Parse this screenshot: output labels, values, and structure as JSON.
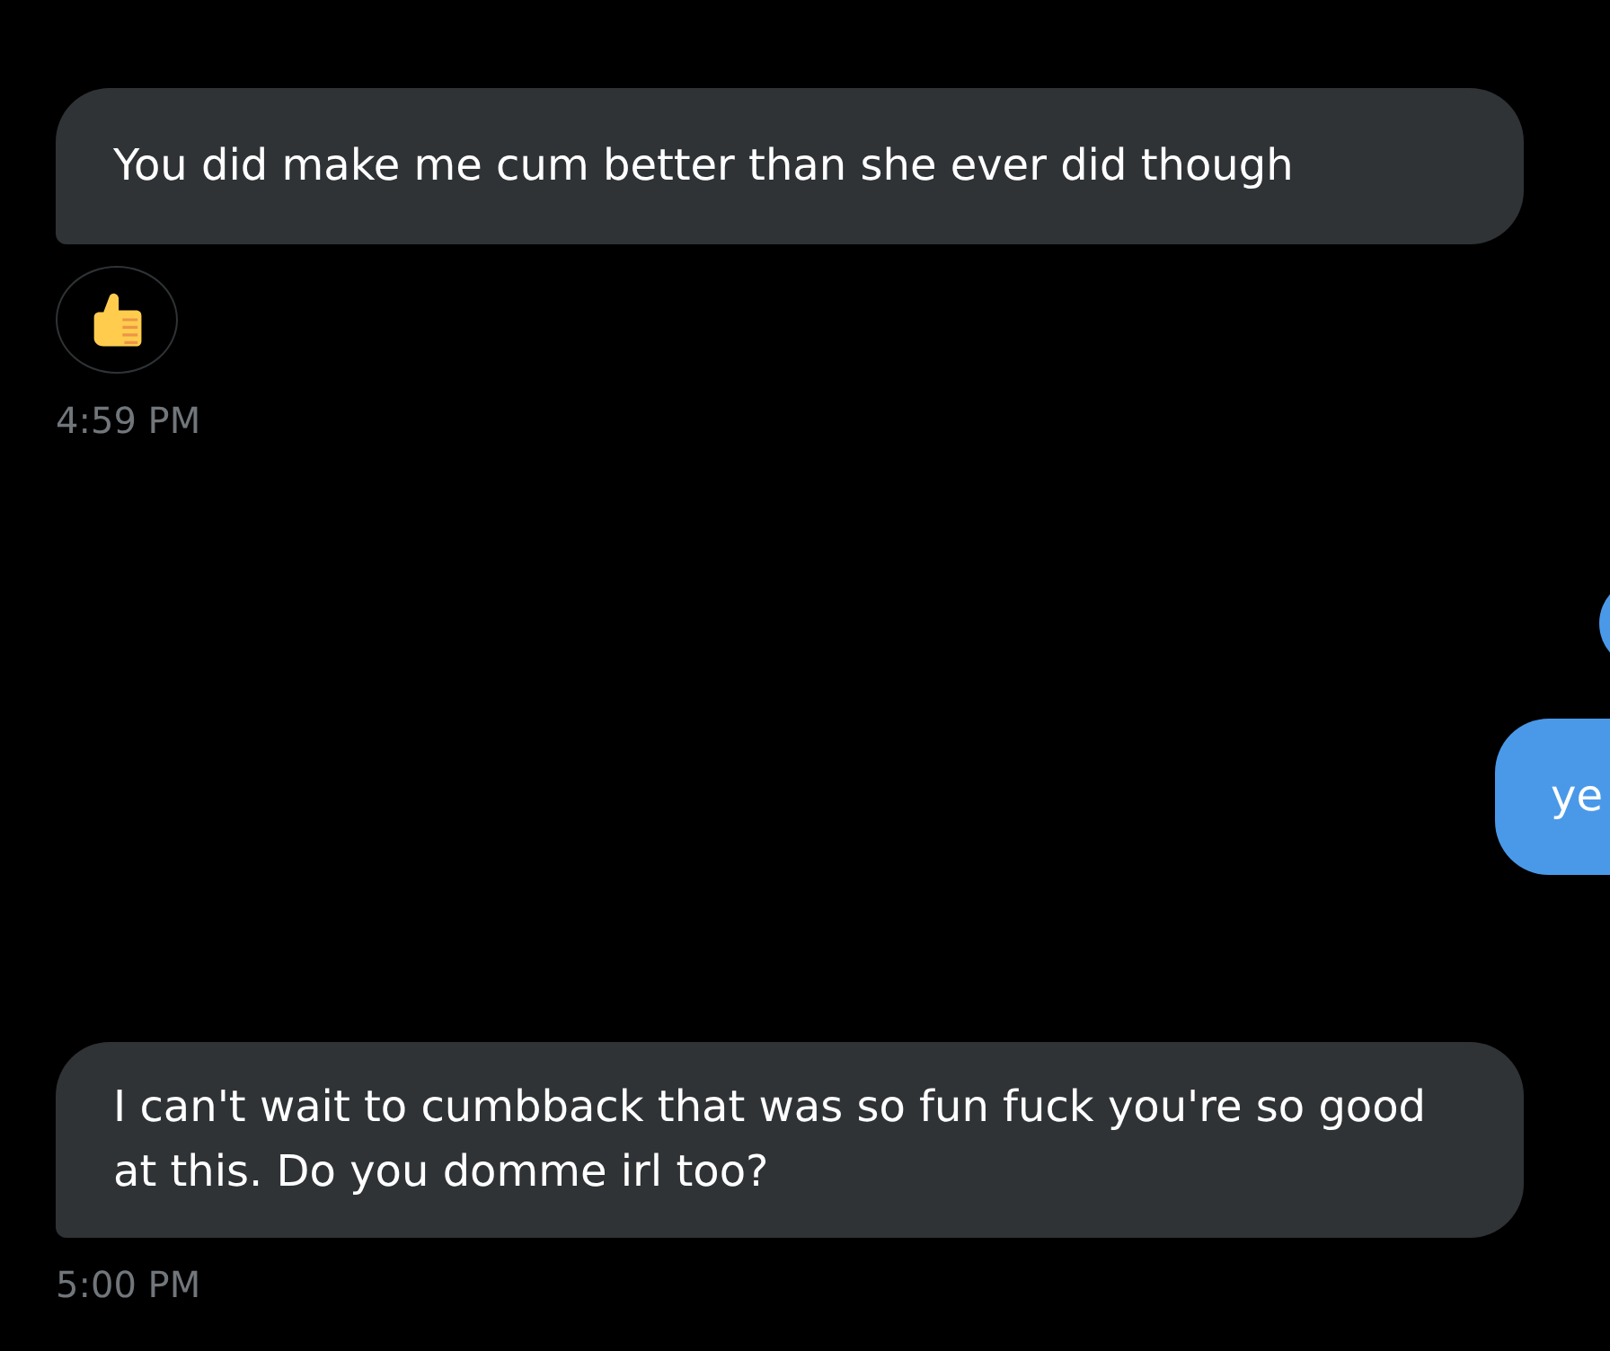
{
  "messages": [
    {
      "kind": "received",
      "text": "You did make me cum better than she ever did though",
      "reacted": true,
      "time": "4:59 PM"
    },
    {
      "kind": "sent"
    },
    {
      "kind": "sent",
      "text": "ye"
    },
    {
      "kind": "received",
      "text": "I can't wait to cumbback that was so fun fuck you're so good at this. Do you domme irl too?",
      "time": "5:00 PM"
    }
  ]
}
